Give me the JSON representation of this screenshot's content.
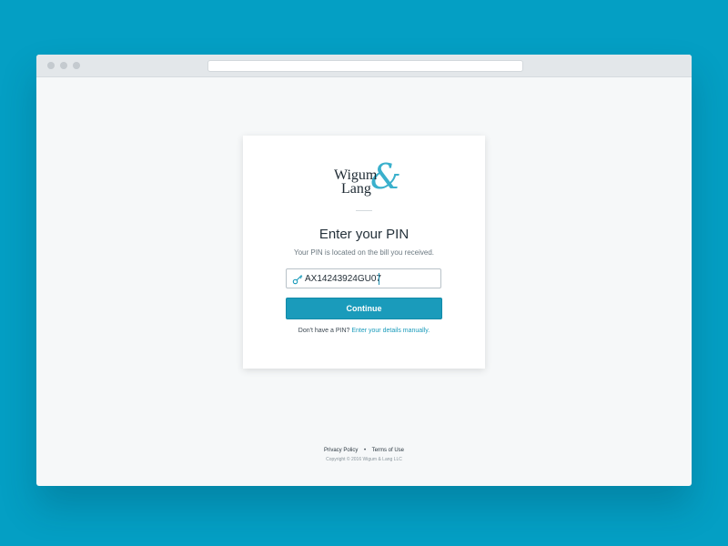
{
  "logo": {
    "line1": "Wigum",
    "line2": "Lang",
    "ampersand": "&"
  },
  "card": {
    "title": "Enter your PIN",
    "subtitle": "Your PIN is located on the bill you received."
  },
  "pin": {
    "value": "AX14243924GU07",
    "icon": "key-icon"
  },
  "continue_label": "Continue",
  "help": {
    "prefix": "Don't have a PIN?",
    "link": "Enter your details manually."
  },
  "footer": {
    "privacy": "Privacy Policy",
    "separator": "•",
    "terms": "Terms of Use",
    "copyright": "Copyright © 2016 Wigum & Lang LLC"
  },
  "colors": {
    "background": "#049fc4",
    "accent": "#1a9bbb",
    "logo_accent": "#3ab0cc"
  }
}
